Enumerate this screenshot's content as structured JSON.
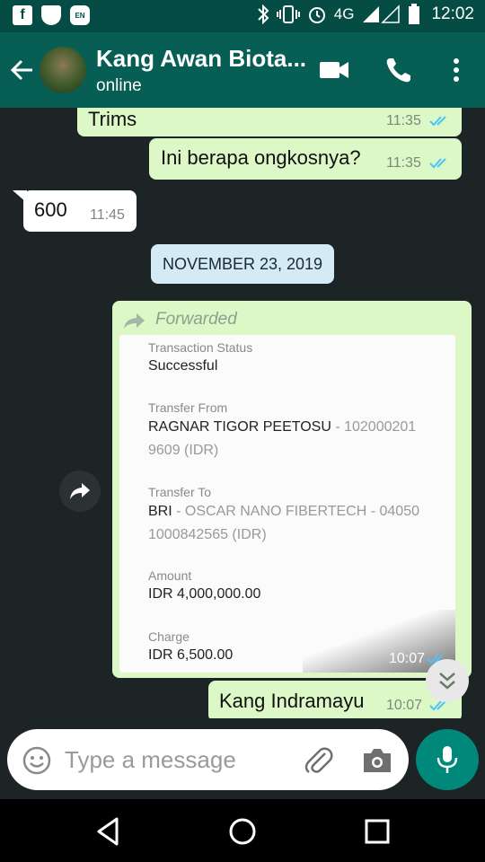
{
  "status_bar": {
    "icons": [
      "facebook-icon",
      "shield-icon",
      "app-badge-icon",
      "bluetooth-icon",
      "vibrate-icon",
      "alarm-icon",
      "signal-icon",
      "battery-icon"
    ],
    "fb_glyph": "f",
    "badge_glyph": "EN",
    "network": "4G",
    "time": "12:02"
  },
  "header": {
    "contact_name": "Kang Awan Biota...",
    "status": "online",
    "icons": [
      "back-arrow-icon",
      "video-call-icon",
      "phone-icon",
      "more-vert-icon"
    ]
  },
  "messages": [
    {
      "text": "Trims",
      "time": "11:35",
      "type": "outgoing",
      "read": true
    },
    {
      "text": "Ini berapa ongkosnya?",
      "time": "11:35",
      "type": "outgoing",
      "read": true
    },
    {
      "text": "600",
      "time": "11:45",
      "type": "incoming"
    },
    {
      "text": "Kang Indramayu",
      "time": "10:07",
      "type": "outgoing",
      "read": true
    }
  ],
  "date_separator": "NOVEMBER 23, 2019",
  "forwarded": {
    "label": "Forwarded",
    "time": "10:07",
    "receipt": {
      "status_label": "Transaction Status",
      "status_value": "Successful",
      "from_label": "Transfer From",
      "from_name": "RAGNAR TIGOR PEETOSU",
      "from_account": " - 102000201 9609 (IDR)",
      "to_label": "Transfer To",
      "to_bank": "BRI",
      "to_account": " - OSCAR NANO FIBERTECH - 04050 1000842565 (IDR)",
      "amount_label": "Amount",
      "amount_value": "IDR 4,000,000.00",
      "charge_label": "Charge",
      "charge_value": "IDR 6,500.00"
    }
  },
  "input": {
    "placeholder": "Type a message"
  },
  "colors": {
    "header": "#075e54",
    "status_bar": "#054d44",
    "outgoing_bubble": "#dcf8c6",
    "incoming_bubble": "#ffffff",
    "read_ticks": "#4fc3f7",
    "mic_button": "#00897b",
    "chat_background": "#1c2426"
  },
  "nav_icons": [
    "nav-back-icon",
    "nav-home-icon",
    "nav-recents-icon"
  ]
}
